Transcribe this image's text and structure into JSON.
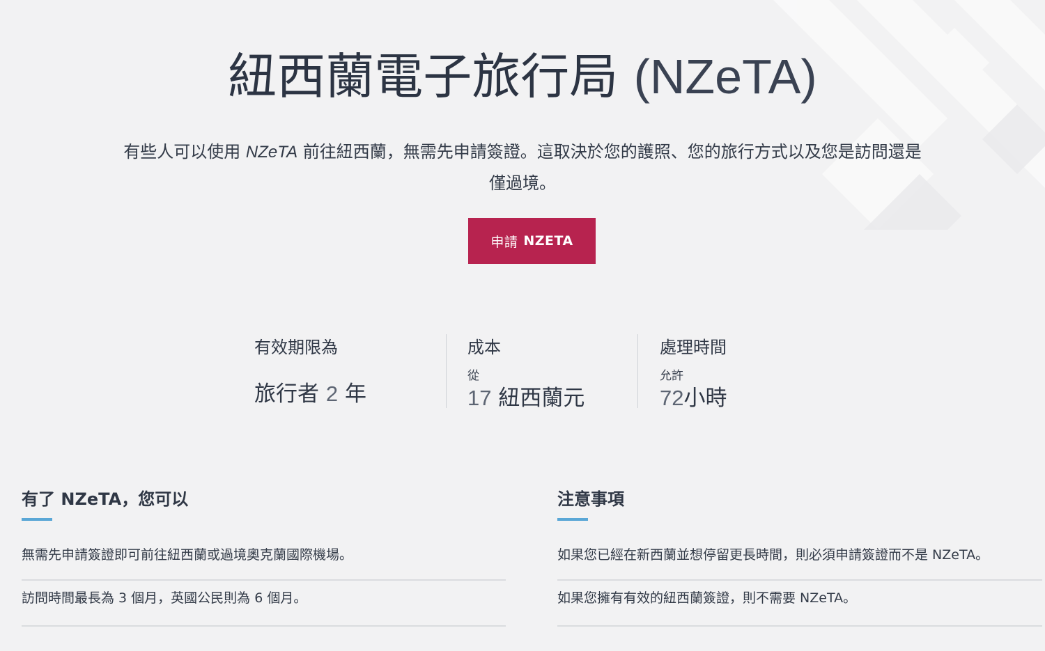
{
  "hero": {
    "title_cjk": "紐西蘭電子旅行局",
    "title_latin": "(NZeTA)",
    "lede_before": "有些人可以使用 ",
    "lede_italic": "NZeTA",
    "lede_after": " 前往紐西蘭，無需先申請簽證。這取決於您的護照、您的旅行方式以及您是訪問還是僅過境。",
    "apply_prefix": "申請",
    "apply_bold": "NZETA"
  },
  "facts": {
    "validity": {
      "label": "有效期限為",
      "value_before": "旅行者",
      "value_num": "2",
      "value_after": "年"
    },
    "cost": {
      "label": "成本",
      "small": "從",
      "value_num": "17",
      "value_after": "紐西蘭元"
    },
    "processing": {
      "label": "處理時間",
      "small": "允許",
      "value_num": "72",
      "value_after": "小時"
    }
  },
  "can": {
    "head_before": "有了 ",
    "head_bold": "NZeTA",
    "head_after": "，您可以",
    "items": [
      "無需先申請簽證即可前往紐西蘭或過境奧克蘭國際機場。",
      "訪問時間最長為 3 個月，英國公民則為 6 個月。"
    ]
  },
  "notes": {
    "head": "注意事項",
    "items": [
      "如果您已經在新西蘭並想停留更長時間，則必須申請簽證而不是 NZeTA。",
      "如果您擁有有效的紐西蘭簽證，則不需要 NZeTA。"
    ]
  },
  "colors": {
    "accent": "#5aa7d6",
    "button": "#b7234f",
    "background": "#f2f2f3"
  }
}
